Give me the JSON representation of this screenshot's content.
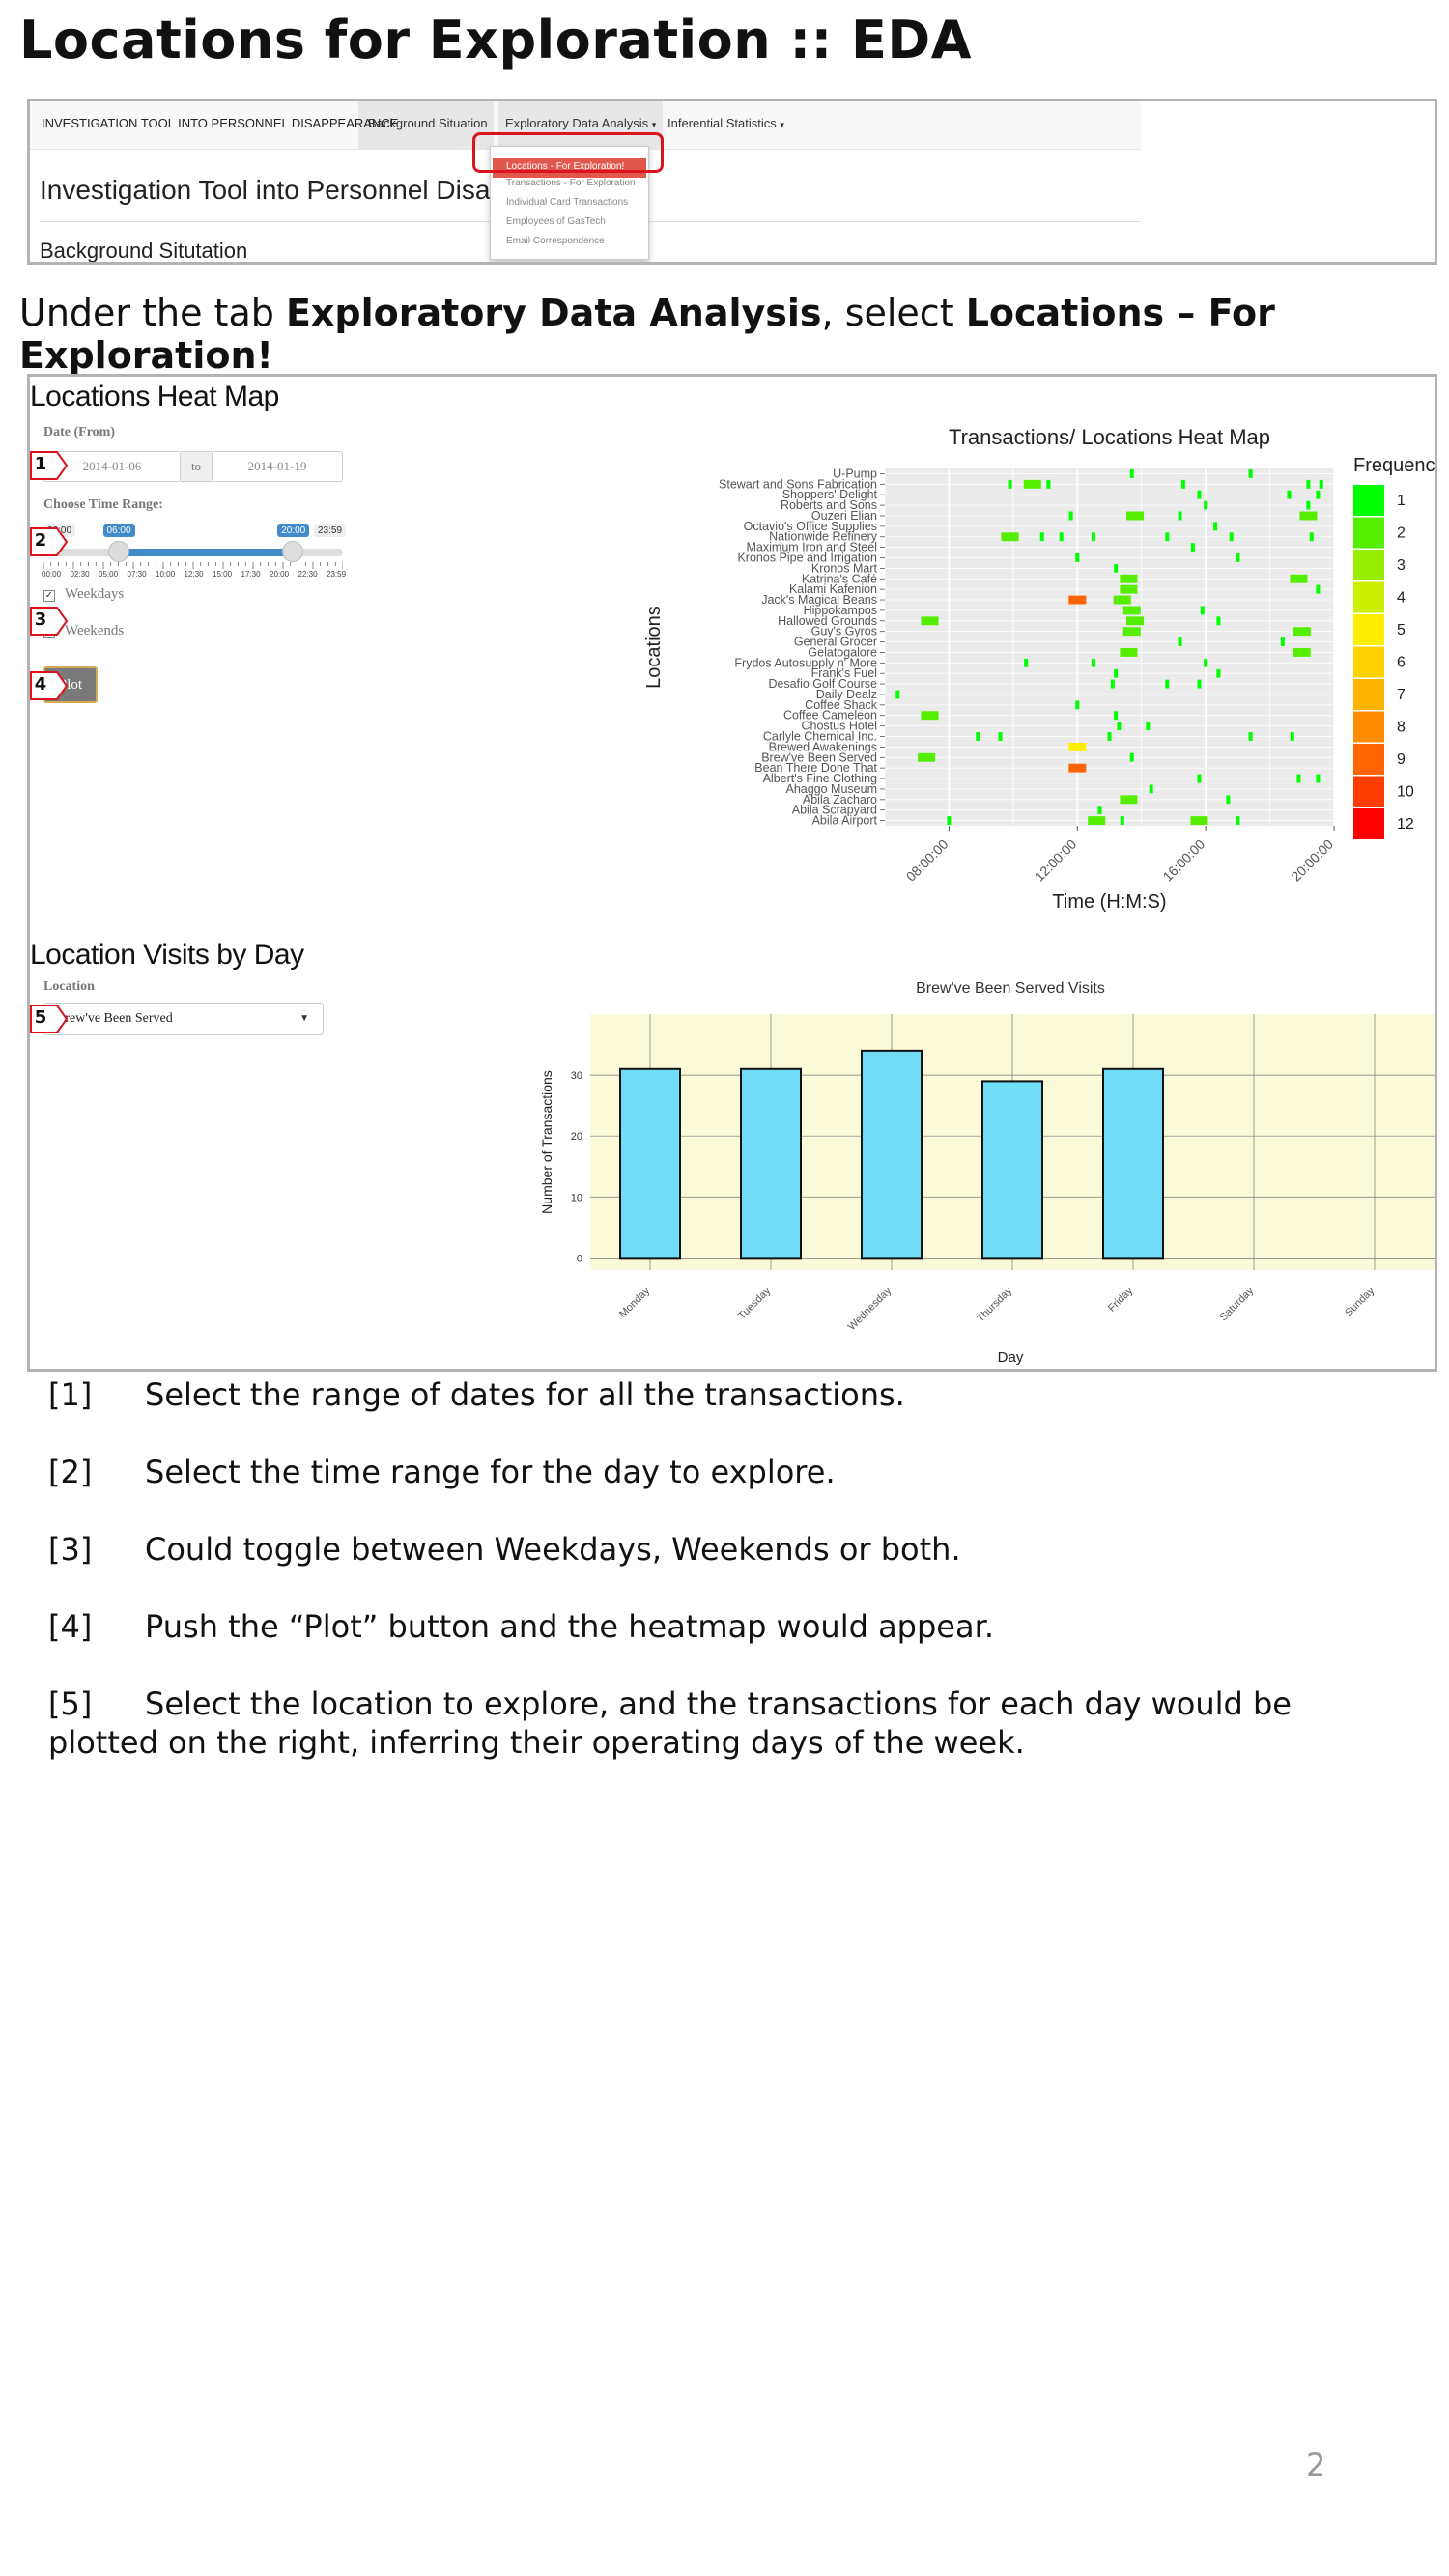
{
  "slide": {
    "title": "Locations for Exploration :: EDA",
    "page_number": "2"
  },
  "navbar": {
    "brand": "INVESTIGATION TOOL INTO PERSONNEL DISAPPEARANCE",
    "items": [
      "Background Situation",
      "Exploratory Data Analysis",
      "Inferential Statistics"
    ],
    "dropdown": [
      "Locations - For Exploration!",
      "Transactions - For Exploration",
      "Individual Card Transactions",
      "Employees of GasTech",
      "Email Correspondence"
    ],
    "app_heading": "Investigation Tool into Personnel Disappe",
    "section_heading": "Background Situtation"
  },
  "instruction": {
    "pre": "Under the tab ",
    "tab": "Exploratory Data Analysis",
    "mid": ", select ",
    "item": "Locations – For Exploration!"
  },
  "heatmap_panel": {
    "title": "Locations Heat Map",
    "date_label": "Date (From)",
    "date_from": "2014-01-06",
    "date_to_word": "to",
    "date_to": "2014-01-19",
    "time_label": "Choose Time Range:",
    "slider_min": "00:00",
    "slider_max": "23:59",
    "slider_low": "06:00",
    "slider_high": "20:00",
    "slider_low_fraction": 0.25,
    "slider_high_fraction": 0.833,
    "slider_ticks": [
      "00:00",
      "02:30",
      "05:00",
      "07:30",
      "10:00",
      "12:30",
      "15:00",
      "17:30",
      "20:00",
      "22:30",
      "23:59"
    ],
    "weekdays_label": "Weekdays",
    "weekends_label": "Weekends",
    "plot_label": "Plot"
  },
  "visits_panel": {
    "title": "Location Visits by Day",
    "location_label": "Location",
    "selected_location": "Brew've Been Served"
  },
  "markers": [
    "1",
    "2",
    "3",
    "4",
    "5"
  ],
  "chart_data": [
    {
      "type": "heatmap",
      "title": "Transactions/ Locations Heat Map",
      "xlabel": "Time (H:M:S)",
      "ylabel": "Locations",
      "x_ticks": [
        "08:00:00",
        "12:00:00",
        "16:00:00",
        "20:00:00"
      ],
      "xlim_hours": [
        6,
        20
      ],
      "legend_title": "Frequency",
      "legend": [
        {
          "label": "1",
          "color": "#00ff00"
        },
        {
          "label": "2",
          "color": "#55ee00"
        },
        {
          "label": "3",
          "color": "#99ee00"
        },
        {
          "label": "4",
          "color": "#ccee00"
        },
        {
          "label": "5",
          "color": "#ffee00"
        },
        {
          "label": "6",
          "color": "#ffd200"
        },
        {
          "label": "7",
          "color": "#ffb400"
        },
        {
          "label": "8",
          "color": "#ff8c00"
        },
        {
          "label": "9",
          "color": "#ff6400"
        },
        {
          "label": "10",
          "color": "#ff3c00"
        },
        {
          "label": "12",
          "color": "#ff0000"
        }
      ],
      "locations": [
        "U-Pump",
        "Stewart and Sons Fabrication",
        "Shoppers' Delight",
        "Roberts and Sons",
        "Ouzeri Elian",
        "Octavio's Office Supplies",
        "Nationwide Refinery",
        "Maximum Iron and Steel",
        "Kronos Pipe and Irrigation",
        "Kronos Mart",
        "Katrina's Café",
        "Kalami Kafenion",
        "Jack's Magical Beans",
        "Hippokampos",
        "Hallowed Grounds",
        "Guy's Gyros",
        "General Grocer",
        "Gelatogalore",
        "Frydos Autosupply n' More",
        "Frank's Fuel",
        "Desafio Golf Course",
        "Daily Dealz",
        "Coffee Shack",
        "Coffee Cameleon",
        "Chostus Hotel",
        "Carlyle Chemical Inc.",
        "Brewed Awakenings",
        "Brew've Been Served",
        "Bean There Done That",
        "Albert's Fine Clothing",
        "Ahaggo Museum",
        "Abila Zacharo",
        "Abila Scrapyard",
        "Abila Airport"
      ],
      "cells": [
        {
          "loc": "U-Pump",
          "t": 13.7,
          "f": 1
        },
        {
          "loc": "U-Pump",
          "t": 17.4,
          "f": 1
        },
        {
          "loc": "Stewart and Sons Fabrication",
          "t": 9.9,
          "f": 1
        },
        {
          "loc": "Stewart and Sons Fabrication",
          "t": 10.6,
          "f": 2
        },
        {
          "loc": "Stewart and Sons Fabrication",
          "t": 11.1,
          "f": 1
        },
        {
          "loc": "Stewart and Sons Fabrication",
          "t": 15.3,
          "f": 1
        },
        {
          "loc": "Stewart and Sons Fabrication",
          "t": 19.2,
          "f": 1
        },
        {
          "loc": "Stewart and Sons Fabrication",
          "t": 19.6,
          "f": 1
        },
        {
          "loc": "Shoppers' Delight",
          "t": 15.8,
          "f": 1
        },
        {
          "loc": "Shoppers' Delight",
          "t": 18.6,
          "f": 1
        },
        {
          "loc": "Shoppers' Delight",
          "t": 19.5,
          "f": 1
        },
        {
          "loc": "Roberts and Sons",
          "t": 16.0,
          "f": 1
        },
        {
          "loc": "Roberts and Sons",
          "t": 19.2,
          "f": 1
        },
        {
          "loc": "Ouzeri Elian",
          "t": 11.8,
          "f": 1
        },
        {
          "loc": "Ouzeri Elian",
          "t": 13.8,
          "f": 2
        },
        {
          "loc": "Ouzeri Elian",
          "t": 15.2,
          "f": 1
        },
        {
          "loc": "Ouzeri Elian",
          "t": 19.2,
          "f": 2
        },
        {
          "loc": "Octavio's Office Supplies",
          "t": 16.3,
          "f": 1
        },
        {
          "loc": "Nationwide Refinery",
          "t": 9.9,
          "f": 2
        },
        {
          "loc": "Nationwide Refinery",
          "t": 10.9,
          "f": 1
        },
        {
          "loc": "Nationwide Refinery",
          "t": 11.5,
          "f": 1
        },
        {
          "loc": "Nationwide Refinery",
          "t": 12.5,
          "f": 1
        },
        {
          "loc": "Nationwide Refinery",
          "t": 14.8,
          "f": 1
        },
        {
          "loc": "Nationwide Refinery",
          "t": 16.8,
          "f": 1
        },
        {
          "loc": "Nationwide Refinery",
          "t": 19.3,
          "f": 1
        },
        {
          "loc": "Maximum Iron and Steel",
          "t": 15.6,
          "f": 1
        },
        {
          "loc": "Kronos Pipe and Irrigation",
          "t": 12.0,
          "f": 1
        },
        {
          "loc": "Kronos Pipe and Irrigation",
          "t": 17.0,
          "f": 1
        },
        {
          "loc": "Kronos Mart",
          "t": 13.2,
          "f": 1
        },
        {
          "loc": "Katrina's Café",
          "t": 13.6,
          "f": 2
        },
        {
          "loc": "Katrina's Café",
          "t": 18.9,
          "f": 2
        },
        {
          "loc": "Kalami Kafenion",
          "t": 13.6,
          "f": 2
        },
        {
          "loc": "Kalami Kafenion",
          "t": 19.5,
          "f": 1
        },
        {
          "loc": "Jack's Magical Beans",
          "t": 12.0,
          "f": 9
        },
        {
          "loc": "Jack's Magical Beans",
          "t": 13.4,
          "f": 2
        },
        {
          "loc": "Hippokampos",
          "t": 13.7,
          "f": 2
        },
        {
          "loc": "Hippokampos",
          "t": 15.9,
          "f": 1
        },
        {
          "loc": "Hallowed Grounds",
          "t": 7.4,
          "f": 2
        },
        {
          "loc": "Hallowed Grounds",
          "t": 13.8,
          "f": 2
        },
        {
          "loc": "Hallowed Grounds",
          "t": 16.4,
          "f": 1
        },
        {
          "loc": "Guy's Gyros",
          "t": 13.7,
          "f": 2
        },
        {
          "loc": "Guy's Gyros",
          "t": 19.0,
          "f": 2
        },
        {
          "loc": "General Grocer",
          "t": 15.2,
          "f": 1
        },
        {
          "loc": "General Grocer",
          "t": 18.4,
          "f": 1
        },
        {
          "loc": "Gelatogalore",
          "t": 13.6,
          "f": 2
        },
        {
          "loc": "Gelatogalore",
          "t": 19.0,
          "f": 2
        },
        {
          "loc": "Frydos Autosupply n' More",
          "t": 10.4,
          "f": 1
        },
        {
          "loc": "Frydos Autosupply n' More",
          "t": 12.5,
          "f": 1
        },
        {
          "loc": "Frydos Autosupply n' More",
          "t": 16.0,
          "f": 1
        },
        {
          "loc": "Frank's Fuel",
          "t": 13.2,
          "f": 1
        },
        {
          "loc": "Frank's Fuel",
          "t": 16.4,
          "f": 1
        },
        {
          "loc": "Desafio Golf Course",
          "t": 13.1,
          "f": 1
        },
        {
          "loc": "Desafio Golf Course",
          "t": 14.8,
          "f": 1
        },
        {
          "loc": "Desafio Golf Course",
          "t": 15.8,
          "f": 1
        },
        {
          "loc": "Daily Dealz",
          "t": 6.4,
          "f": 1
        },
        {
          "loc": "Coffee Shack",
          "t": 12.0,
          "f": 1
        },
        {
          "loc": "Coffee Cameleon",
          "t": 7.4,
          "f": 2
        },
        {
          "loc": "Coffee Cameleon",
          "t": 13.2,
          "f": 1
        },
        {
          "loc": "Chostus Hotel",
          "t": 13.3,
          "f": 1
        },
        {
          "loc": "Chostus Hotel",
          "t": 14.2,
          "f": 1
        },
        {
          "loc": "Carlyle Chemical Inc.",
          "t": 8.9,
          "f": 1
        },
        {
          "loc": "Carlyle Chemical Inc.",
          "t": 9.6,
          "f": 1
        },
        {
          "loc": "Carlyle Chemical Inc.",
          "t": 13.0,
          "f": 1
        },
        {
          "loc": "Carlyle Chemical Inc.",
          "t": 17.4,
          "f": 1
        },
        {
          "loc": "Carlyle Chemical Inc.",
          "t": 18.7,
          "f": 1
        },
        {
          "loc": "Brewed Awakenings",
          "t": 12.0,
          "f": 5
        },
        {
          "loc": "Brew've Been Served",
          "t": 7.3,
          "f": 2
        },
        {
          "loc": "Brew've Been Served",
          "t": 13.7,
          "f": 1
        },
        {
          "loc": "Bean There Done That",
          "t": 12.0,
          "f": 9
        },
        {
          "loc": "Albert's Fine Clothing",
          "t": 15.8,
          "f": 1
        },
        {
          "loc": "Albert's Fine Clothing",
          "t": 18.9,
          "f": 1
        },
        {
          "loc": "Albert's Fine Clothing",
          "t": 19.5,
          "f": 1
        },
        {
          "loc": "Ahaggo Museum",
          "t": 14.3,
          "f": 1
        },
        {
          "loc": "Abila Zacharo",
          "t": 13.6,
          "f": 2
        },
        {
          "loc": "Abila Zacharo",
          "t": 16.7,
          "f": 1
        },
        {
          "loc": "Abila Scrapyard",
          "t": 12.7,
          "f": 1
        },
        {
          "loc": "Abila Airport",
          "t": 8.0,
          "f": 1
        },
        {
          "loc": "Abila Airport",
          "t": 12.6,
          "f": 2
        },
        {
          "loc": "Abila Airport",
          "t": 13.4,
          "f": 1
        },
        {
          "loc": "Abila Airport",
          "t": 15.8,
          "f": 2
        },
        {
          "loc": "Abila Airport",
          "t": 17.0,
          "f": 1
        }
      ]
    },
    {
      "type": "bar",
      "title": "Brew've Been Served Visits",
      "xlabel": "Day",
      "ylabel": "Number of Transactions",
      "categories": [
        "Monday",
        "Tuesday",
        "Wednesday",
        "Thursday",
        "Friday",
        "Saturday",
        "Sunday"
      ],
      "values": [
        31,
        31,
        34,
        29,
        31,
        0,
        0
      ],
      "ylim": [
        -2,
        40
      ],
      "yticks": [
        0,
        10,
        20,
        30
      ],
      "bar_color": "#70dcf6",
      "background": "#fafad8"
    }
  ],
  "notes": [
    {
      "num": "[1]",
      "text": "Select the range of  dates for all the transactions."
    },
    {
      "num": "[2]",
      "text": "Select the time range for the day to explore."
    },
    {
      "num": "[3]",
      "text": "Could toggle between Weekdays, Weekends or both."
    },
    {
      "num": "[4]",
      "text": "Push the “Plot” button and the heatmap would appear."
    },
    {
      "num": "[5]",
      "text": "Select the location to explore, and the transactions for each day would be plotted on the right, inferring their operating days of  the week."
    }
  ]
}
